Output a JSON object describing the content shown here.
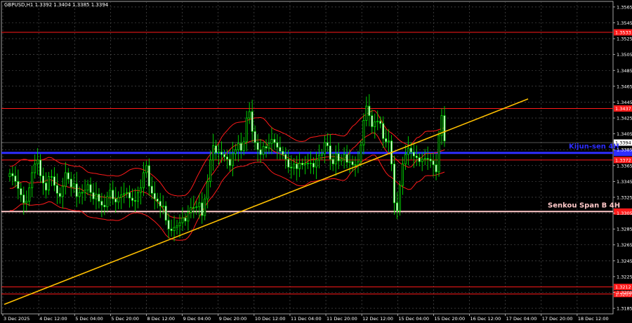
{
  "chart_data": {
    "type": "candlestick",
    "header": "GBPUSD,H1  1.3392 1.3404 1.3385 1.3394",
    "ylim": [
      1.3178,
      1.3572
    ],
    "y_ticks": [
      "1.3565",
      "1.3545",
      "1.3525",
      "1.3505",
      "1.3485",
      "1.3465",
      "1.3445",
      "1.3425",
      "1.3405",
      "1.3385",
      "1.3365",
      "1.3345",
      "1.3325",
      "1.3305",
      "1.3285",
      "1.3265",
      "1.3245",
      "1.3225",
      "1.3205",
      "1.3185"
    ],
    "x_ticks": [
      "3 Dec 2025",
      "4 Dec 12:00",
      "5 Dec 04:00",
      "5 Dec 20:00",
      "8 Dec 12:00",
      "9 Dec 04:00",
      "9 Dec 20:00",
      "10 Dec 12:00",
      "11 Dec 04:00",
      "11 Dec 20:00",
      "12 Dec 12:00",
      "15 Dec 04:00",
      "15 Dec 20:00",
      "16 Dec 12:00",
      "17 Dec 04:00",
      "17 Dec 20:00",
      "18 Dec 12:00"
    ],
    "current_price": "1.3394",
    "level_lines": [
      {
        "price": 1.3533,
        "label": "1.3533",
        "color": "#ff1a1a"
      },
      {
        "price": 1.3437,
        "label": "1.3437",
        "color": "#ff1a1a"
      },
      {
        "price": 1.3372,
        "label": "1.3372",
        "color": "#ff1a1a"
      },
      {
        "price": 1.3203,
        "label": "1.3203",
        "color": "#ff1a1a"
      },
      {
        "price": 1.3212,
        "label": "1.3212",
        "color": "#ff1a1a"
      }
    ],
    "kijun": {
      "name": "Kijun-sen 4H",
      "price": 1.3381,
      "color": "#2d2dff"
    },
    "senkou": {
      "name": "Senkou Span B 4H",
      "price": 1.3307,
      "color": "#ffc8c8"
    },
    "trendline": {
      "points": [
        [
          0,
          1.319
        ],
        [
          188,
          1.3449
        ]
      ],
      "color": "#ffc000"
    },
    "candles": [
      1.3355,
      1.3352,
      1.3345,
      1.3336,
      1.3328,
      1.3318,
      1.332,
      1.3337,
      1.3356,
      1.3367,
      1.3372,
      1.3352,
      1.3343,
      1.3334,
      1.3351,
      1.3351,
      1.334,
      1.333,
      1.3326,
      1.3339,
      1.3356,
      1.3348,
      1.3338,
      1.3342,
      1.3326,
      1.3331,
      1.3331,
      1.3334,
      1.3341,
      1.3331,
      1.3323,
      1.3329,
      1.332,
      1.3315,
      1.3313,
      1.3326,
      1.3334,
      1.3323,
      1.3319,
      1.3325,
      1.3328,
      1.333,
      1.3331,
      1.3324,
      1.3321,
      1.332,
      1.3331,
      1.3337,
      1.3356,
      1.3365,
      1.3339,
      1.333,
      1.3323,
      1.332,
      1.3314,
      1.3314,
      1.3296,
      1.3285,
      1.3283,
      1.3287,
      1.3289,
      1.3293,
      1.3299,
      1.3295,
      1.3306,
      1.3312,
      1.3312,
      1.3313,
      1.3318,
      1.3302,
      1.3323,
      1.3345,
      1.3372,
      1.339,
      1.3381,
      1.3382,
      1.3379,
      1.3376,
      1.3373,
      1.3365,
      1.338,
      1.3385,
      1.3393,
      1.3384,
      1.3395,
      1.3425,
      1.3433,
      1.3408,
      1.3394,
      1.3385,
      1.3379,
      1.3389,
      1.3387,
      1.3393,
      1.3398,
      1.3394,
      1.3388,
      1.3383,
      1.3379,
      1.3373,
      1.3363,
      1.3362,
      1.3367,
      1.3361,
      1.3368,
      1.3366,
      1.3368,
      1.3368,
      1.3368,
      1.3363,
      1.3372,
      1.3378,
      1.338,
      1.3394,
      1.339,
      1.3373,
      1.3367,
      1.338,
      1.3371,
      1.3373,
      1.3379,
      1.3369,
      1.337,
      1.3366,
      1.3366,
      1.337,
      1.3391,
      1.3422,
      1.344,
      1.3428,
      1.3414,
      1.342,
      1.3421,
      1.3418,
      1.3399,
      1.3395,
      1.3396,
      1.3367,
      1.3318,
      1.3308,
      1.334,
      1.3367,
      1.3379,
      1.3387,
      1.3382,
      1.3377,
      1.3375,
      1.337,
      1.3373,
      1.3374,
      1.3373,
      1.3371,
      1.3366,
      1.3357,
      1.3403,
      1.3428,
      1.3396
    ],
    "bands": {
      "upper_first": [
        1.3372,
        1.3398
      ],
      "mid_first": [
        1.3372,
        1.3365
      ],
      "lower_first": [
        1.3265,
        1.3372
      ]
    }
  }
}
